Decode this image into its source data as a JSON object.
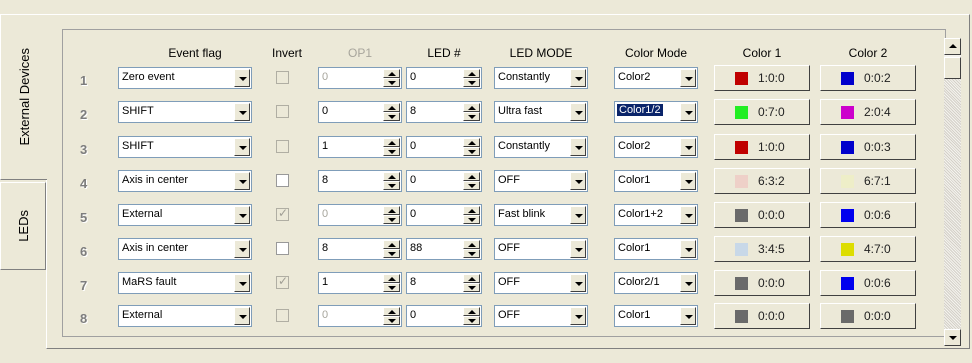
{
  "tabs": [
    {
      "label": "External Devices",
      "selected": true
    },
    {
      "label": "LEDs",
      "selected": false
    }
  ],
  "headers": {
    "event_flag": "Event flag",
    "invert": "Invert",
    "op1": "OP1",
    "led": "LED #",
    "led_mode": "LED MODE",
    "color_mode": "Color Mode",
    "color1": "Color 1",
    "color2": "Color 2"
  },
  "rows": [
    {
      "num": "1",
      "event": "Zero event",
      "invert_checked": false,
      "invert_enabled": false,
      "op1": "0",
      "op1_enabled": false,
      "led": "0",
      "led_mode": "Constantly",
      "color_mode": "Color2",
      "color_mode_selected": false,
      "c1_label": "1:0:0",
      "c1_color": "#c00000",
      "c2_label": "0:0:2",
      "c2_color": "#0000cc"
    },
    {
      "num": "2",
      "event": "SHIFT",
      "invert_checked": false,
      "invert_enabled": false,
      "op1": "0",
      "op1_enabled": true,
      "led": "8",
      "led_mode": "Ultra fast",
      "color_mode": "Color1/2",
      "color_mode_selected": true,
      "c1_label": "0:7:0",
      "c1_color": "#22ee22",
      "c2_label": "2:0:4",
      "c2_color": "#cc00cc"
    },
    {
      "num": "3",
      "event": "SHIFT",
      "invert_checked": false,
      "invert_enabled": false,
      "op1": "1",
      "op1_enabled": true,
      "led": "0",
      "led_mode": "Constantly",
      "color_mode": "Color2",
      "color_mode_selected": false,
      "c1_label": "1:0:0",
      "c1_color": "#c00000",
      "c2_label": "0:0:3",
      "c2_color": "#0000cc"
    },
    {
      "num": "4",
      "event": "Axis in center",
      "invert_checked": false,
      "invert_enabled": true,
      "op1": "8",
      "op1_enabled": true,
      "led": "0",
      "led_mode": "OFF",
      "color_mode": "Color1",
      "color_mode_selected": false,
      "c1_label": "6:3:2",
      "c1_color": "#eed0c8",
      "c2_label": "6:7:1",
      "c2_color": "#eeeec8"
    },
    {
      "num": "5",
      "event": "External",
      "invert_checked": true,
      "invert_enabled": false,
      "op1": "0",
      "op1_enabled": false,
      "led": "0",
      "led_mode": "Fast blink",
      "color_mode": "Color1+2",
      "color_mode_selected": false,
      "c1_label": "0:0:0",
      "c1_color": "#6a6a6a",
      "c2_label": "0:0:6",
      "c2_color": "#0000ee"
    },
    {
      "num": "6",
      "event": "Axis in center",
      "invert_checked": false,
      "invert_enabled": true,
      "op1": "8",
      "op1_enabled": true,
      "led": "88",
      "led_mode": "OFF",
      "color_mode": "Color1",
      "color_mode_selected": false,
      "c1_label": "3:4:5",
      "c1_color": "#c8d8e8",
      "c2_label": "4:7:0",
      "c2_color": "#dddd00"
    },
    {
      "num": "7",
      "event": "MaRS fault",
      "invert_checked": true,
      "invert_enabled": false,
      "op1": "1",
      "op1_enabled": true,
      "led": "8",
      "led_mode": "OFF",
      "color_mode": "Color2/1",
      "color_mode_selected": false,
      "c1_label": "0:0:0",
      "c1_color": "#6a6a6a",
      "c2_label": "0:0:6",
      "c2_color": "#0000ee"
    },
    {
      "num": "8",
      "event": "External",
      "invert_checked": false,
      "invert_enabled": false,
      "op1": "0",
      "op1_enabled": false,
      "led": "0",
      "led_mode": "OFF",
      "color_mode": "Color1",
      "color_mode_selected": false,
      "c1_label": "0:0:0",
      "c1_color": "#6a6a6a",
      "c2_label": "0:0:0",
      "c2_color": "#6a6a6a"
    }
  ]
}
